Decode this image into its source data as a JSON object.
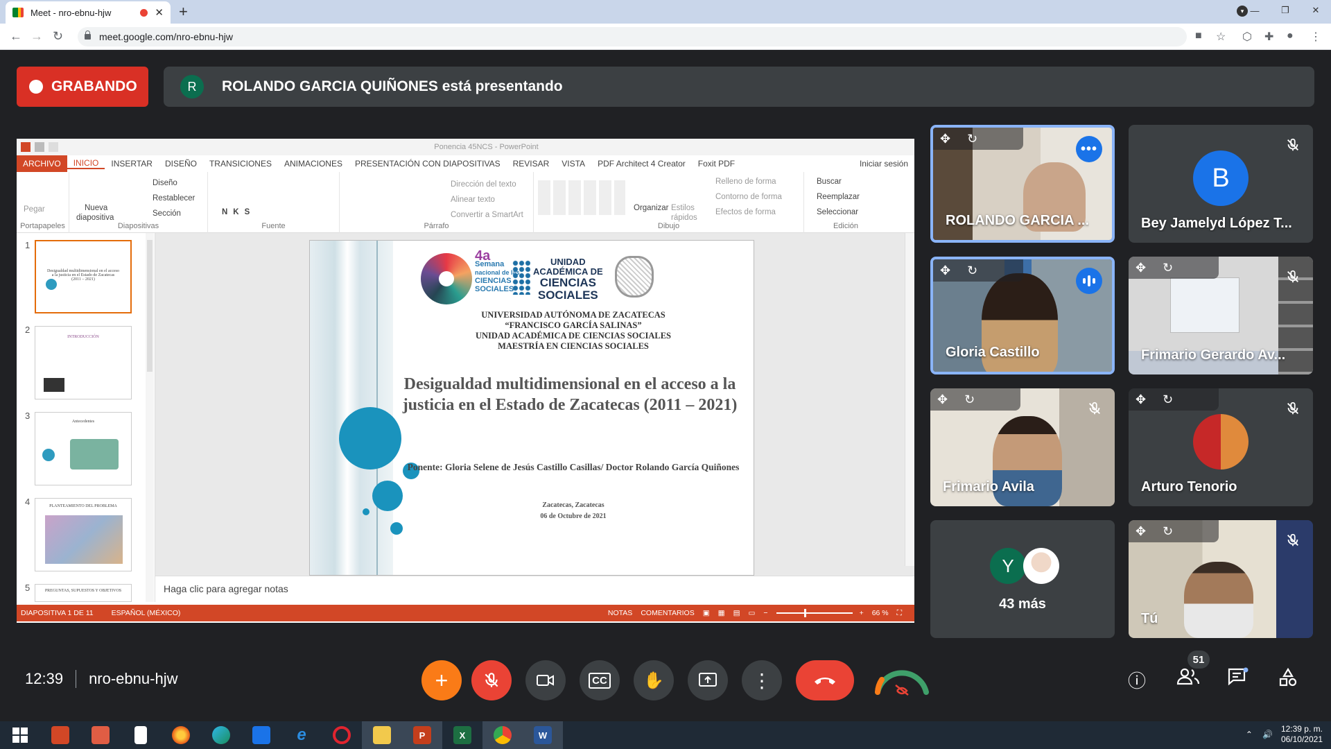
{
  "browser": {
    "tab_title": "Meet - nro-ebnu-hjw",
    "url": "meet.google.com/nro-ebnu-hjw"
  },
  "meet": {
    "recording_label": "GRABANDO",
    "presenter_initial": "R",
    "presenting_text": "ROLANDO GARCIA QUIÑONES está presentando",
    "time": "12:39",
    "meeting_code": "nro-ebnu-hjw",
    "participant_count": "51"
  },
  "ppt": {
    "window_title": "Ponencia 45NCS - PowerPoint",
    "menu": [
      "ARCHIVO",
      "INICIO",
      "INSERTAR",
      "DISEÑO",
      "TRANSICIONES",
      "ANIMACIONES",
      "PRESENTACIÓN CON DIAPOSITIVAS",
      "REVISAR",
      "VISTA",
      "PDF Architect 4 Creator",
      "Foxit PDF"
    ],
    "signin": "Iniciar sesión",
    "ribbon": {
      "pegar": "Pegar",
      "nueva": "Nueva",
      "diapositiva": "diapositiva",
      "diseno": "Diseño",
      "restablecer": "Restablecer",
      "seccion": "Sección",
      "direccion_texto": "Dirección del texto",
      "alinear_texto": "Alinear texto",
      "convertir_smartart": "Convertir a SmartArt",
      "organizar": "Organizar",
      "estilos": "Estilos",
      "rapidos": "rápidos",
      "relleno": "Relleno de forma",
      "contorno": "Contorno de forma",
      "efectos": "Efectos de forma",
      "buscar": "Buscar",
      "reemplazar": "Reemplazar",
      "seleccionar": "Seleccionar",
      "groups": [
        "Portapapeles",
        "Diapositivas",
        "Fuente",
        "Párrafo",
        "Dibujo",
        "Edición"
      ]
    },
    "thumbs": [
      {
        "num": "1",
        "text": "Desigualdad multidimensional en el acceso a la justicia en el Estado de Zacatecas (2011 – 2021)"
      },
      {
        "num": "2",
        "text": "INTRODUCCIÓN"
      },
      {
        "num": "3",
        "text": "Antecedentes"
      },
      {
        "num": "4",
        "text": "PLANTEAMIENTO DEL PROBLEMA"
      },
      {
        "num": "5",
        "text": "PREGUNTAS, SUPUESTOS Y OBJETIVOS"
      }
    ],
    "slide": {
      "logo_4a": "4a",
      "logo_semana": "Semana",
      "logo_nacional": "nacional de las",
      "logo_ciencias": "CIENCIAS",
      "logo_sociales": "SOCIALES",
      "logo_unidad": "UNIDAD",
      "logo_academica": "ACADÉMICA DE",
      "logo_ciencias2": "CIENCIAS",
      "logo_sociales2": "SOCIALES",
      "uni_lines": [
        "UNIVERSIDAD AUTÓNOMA DE ZACATECAS",
        "“FRANCISCO GARCÍA SALINAS”",
        "UNIDAD ACADÉMICA DE CIENCIAS SOCIALES",
        "MAESTRÍA EN CIENCIAS SOCIALES"
      ],
      "title": "Desigualdad multidimensional en el acceso a la justicia en el Estado de Zacatecas (2011 – 2021)",
      "ponente": "Ponente: Gloria Selene de Jesús Castillo Casillas/ Doctor Rolando García Quiñones",
      "place": "Zacatecas, Zacatecas",
      "date": "06 de Octubre de 2021"
    },
    "notes_placeholder": "Haga clic para agregar notas",
    "status": {
      "slide": "DIAPOSITIVA 1 DE 11",
      "lang": "ESPAÑOL (MÉXICO)",
      "notas": "NOTAS",
      "comentarios": "COMENTARIOS",
      "zoom": "66 %"
    }
  },
  "participants": [
    {
      "name": "ROLANDO GARCIA ..."
    },
    {
      "name": "Bey Jamelyd López T...",
      "initial": "B"
    },
    {
      "name": "Gloria Castillo"
    },
    {
      "name": "Frimario Gerardo Av..."
    },
    {
      "name": "Frimario Avila"
    },
    {
      "name": "Arturo Tenorio"
    },
    {
      "name": "43 más",
      "initial": "Y"
    },
    {
      "name": "Tú"
    }
  ],
  "taskbar": {
    "time": "12:39 p. m.",
    "date": "06/10/2021"
  },
  "colors": {
    "recording": "#d93025",
    "meet_bg": "#202124",
    "tile_bg": "#3c4043",
    "ppt_accent": "#d24726",
    "active_speaker": "#8ab4f8"
  }
}
